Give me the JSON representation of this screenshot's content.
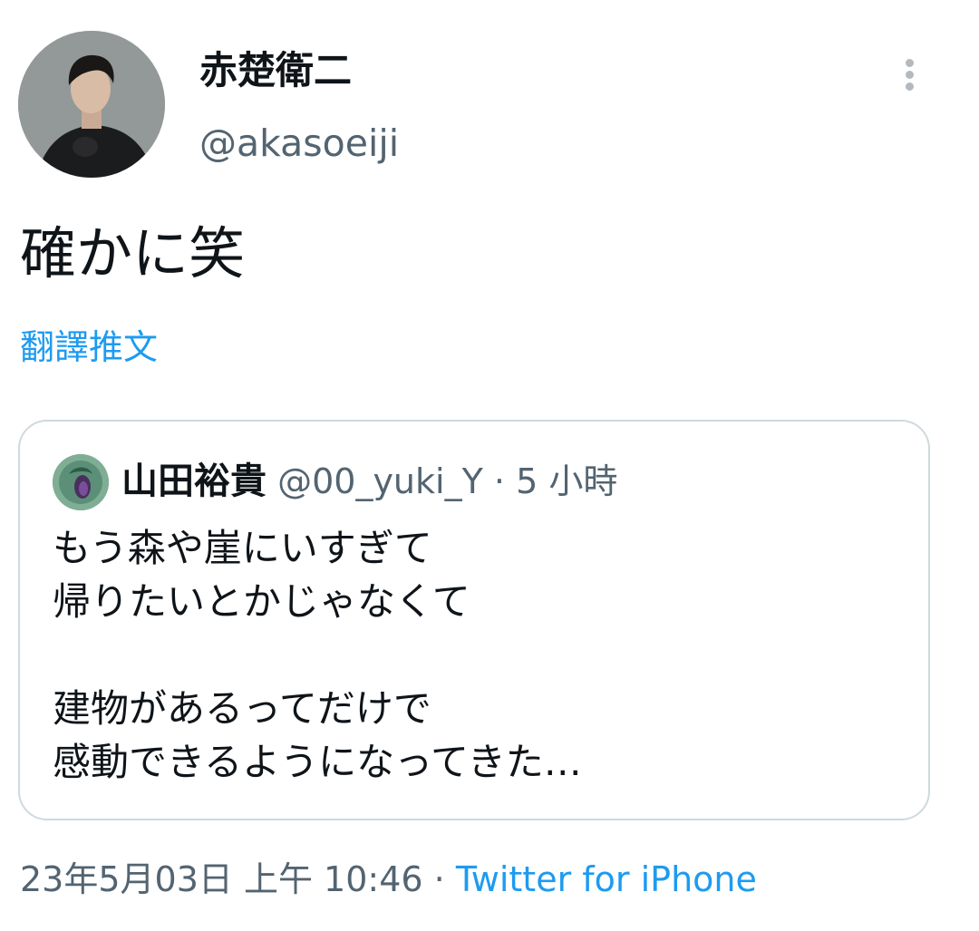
{
  "author": {
    "display_name": "赤楚衛二",
    "handle": "@akasoeiji"
  },
  "tweet": {
    "text": "確かに笑",
    "translate_label": "翻譯推文"
  },
  "quoted_tweet": {
    "display_name": "山田裕貴",
    "handle": "@00_yuki_Y",
    "separator": "·",
    "time": "5 小時",
    "lines": [
      "もう森や崖にいすぎて",
      "帰りたいとかじゃなくて",
      "",
      "建物があるってだけで",
      "感動できるようになってきた…"
    ]
  },
  "meta": {
    "timestamp": "23年5月03日 上午 10:46",
    "separator": "·",
    "source": "Twitter for iPhone"
  },
  "icons": {
    "more": "more-vertical-icon"
  },
  "colors": {
    "link": "#1d9bf0",
    "secondary_text": "#536471",
    "border": "#cfd9de"
  }
}
